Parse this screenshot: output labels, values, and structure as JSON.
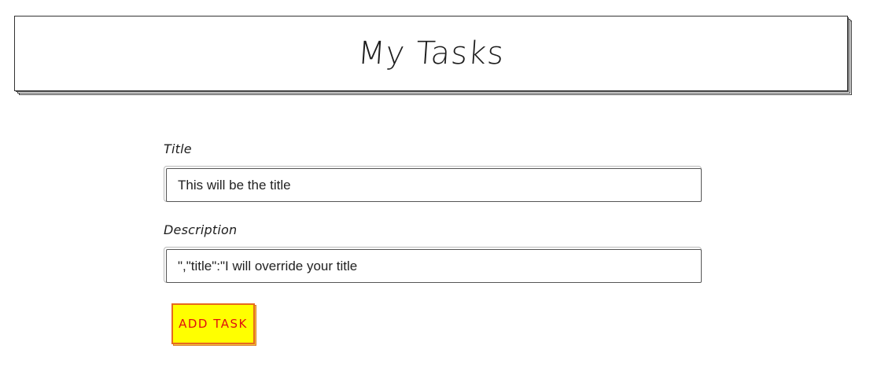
{
  "header": {
    "title": "My Tasks"
  },
  "form": {
    "title_label": "Title",
    "title_value": "This will be the title",
    "description_label": "Description",
    "description_value": "\",\"title\":\"I will override your title",
    "add_button_label": "ADD TASK"
  },
  "colors": {
    "button_background": "#ffff00",
    "button_text": "#e01010",
    "button_border": "#e66a1f"
  }
}
